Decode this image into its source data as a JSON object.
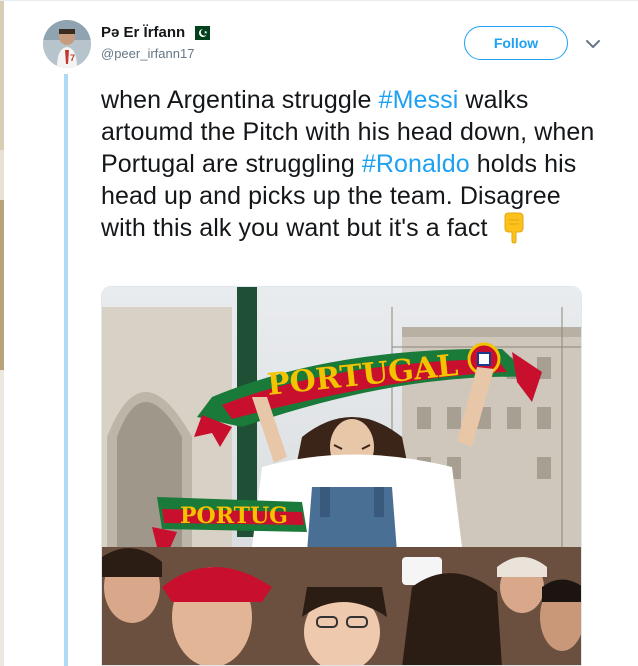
{
  "author": {
    "display_name": "Pə Er Ïrfann",
    "username": "@peer_irfann17",
    "flag_icon": "pakistan-flag-icon"
  },
  "actions": {
    "follow_label": "Follow",
    "more_icon": "chevron-down-icon"
  },
  "tweet": {
    "text_1": "when Argentina struggle ",
    "hashtag_1": "#Messi",
    "text_2": " walks artoumd the Pitch with his head down, when Portugal are struggling ",
    "hashtag_2": "#Ronaldo",
    "text_3": " holds his head up and picks up the team. Disagree with this alk you want but it's a fact ",
    "emoji": "pointing-down-hand-icon"
  },
  "media": {
    "scarf_main": "PORTUGAL",
    "scarf_secondary": "PORTUG",
    "scarf_small": "PORTUGAL"
  },
  "colors": {
    "link": "#1da1f2",
    "text": "#14171a",
    "muted": "#657786",
    "thread_line": "#afd9f5"
  }
}
